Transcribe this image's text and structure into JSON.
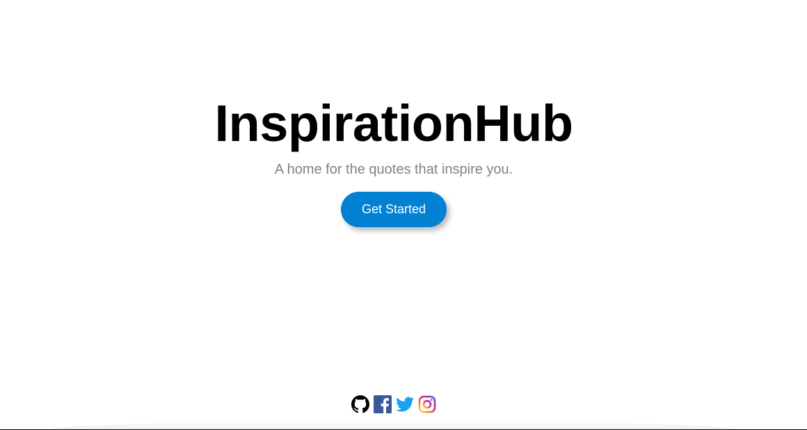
{
  "hero": {
    "title": "InspirationHub",
    "subtitle": "A home for the quotes that inspire you.",
    "cta_label": "Get Started"
  },
  "footer": {
    "social_links": [
      {
        "icon": "github-icon",
        "label": "GitHub"
      },
      {
        "icon": "facebook-icon",
        "label": "Facebook"
      },
      {
        "icon": "twitter-icon",
        "label": "Twitter"
      },
      {
        "icon": "instagram-icon",
        "label": "Instagram"
      }
    ]
  },
  "colors": {
    "accent": "#0280d1",
    "title": "#000000",
    "subtitle": "#808080",
    "facebook": "#3b5998",
    "twitter": "#1da1f2"
  }
}
